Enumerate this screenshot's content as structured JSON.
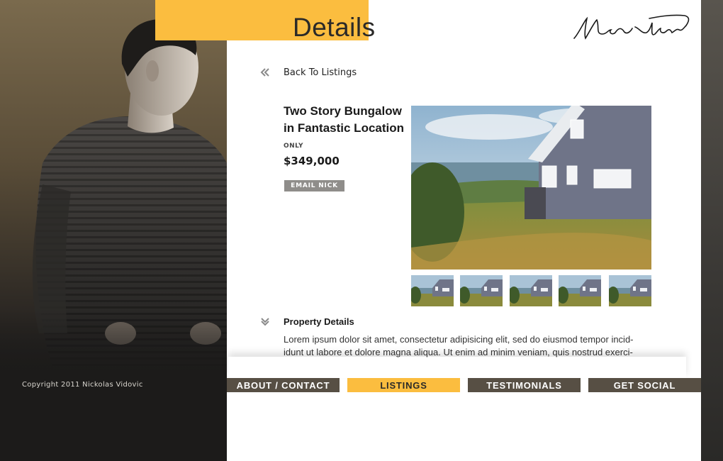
{
  "header": {
    "title": "Details",
    "signature_text": "Nickolas Vidovic"
  },
  "listing": {
    "back_label": "Back To Listings",
    "title": "Two Story Bungalow in Fantastic Location",
    "price_prefix": "ONLY",
    "price": "$349,000",
    "email_button": "EMAIL NICK",
    "thumbnail_count": 5
  },
  "property_details": {
    "heading": "Property Details",
    "text": "Lorem ipsum dolor sit amet, consectetur adipisicing elit, sed do eiusmod tempor incid-idunt ut labore et dolore magna aliqua. Ut enim ad minim veniam, quis nostrud exerci-"
  },
  "nav": {
    "items": [
      {
        "label": "ABOUT / CONTACT",
        "active": false
      },
      {
        "label": "LISTINGS",
        "active": true
      },
      {
        "label": "TESTIMONIALS",
        "active": false
      },
      {
        "label": "GET SOCIAL",
        "active": false
      }
    ]
  },
  "footer": {
    "copyright": "Copyright 2011 Nickolas Vidovic"
  },
  "colors": {
    "accent_yellow": "#fbbd3f",
    "nav_dark": "#574f44",
    "button_gray": "#8f8d8a",
    "text_dark": "#1a1a1a"
  }
}
